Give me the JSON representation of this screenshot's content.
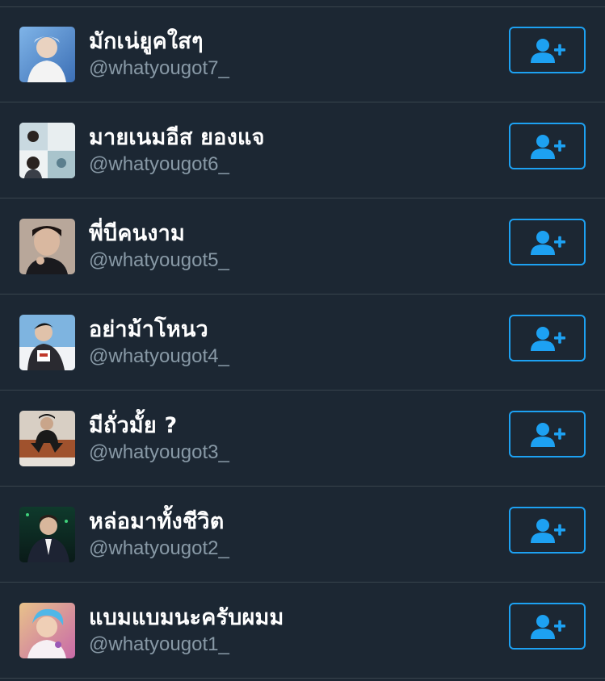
{
  "colors": {
    "background": "#1c2733",
    "divider": "#38444d",
    "name_text": "#ffffff",
    "handle_text": "#8899a6",
    "accent": "#1da1f2"
  },
  "users": [
    {
      "name": "มักเน่ยูคใสๆ",
      "handle": "@whatyougot7_",
      "button_icon": "add-user-icon"
    },
    {
      "name": "มายเนมอีส ยองแจ",
      "handle": "@whatyougot6_",
      "button_icon": "add-user-icon"
    },
    {
      "name": "พี่บีคนงาม",
      "handle": "@whatyougot5_",
      "button_icon": "add-user-icon"
    },
    {
      "name": "อย่าม้าโหนว",
      "handle": "@whatyougot4_",
      "button_icon": "add-user-icon"
    },
    {
      "name": "มีถั่วมั้ย ?",
      "handle": "@whatyougot3_",
      "button_icon": "add-user-icon"
    },
    {
      "name": "หล่อมาทั้งชีวิต",
      "handle": "@whatyougot2_",
      "button_icon": "add-user-icon"
    },
    {
      "name": "แบมแบมนะครับผมม",
      "handle": "@whatyougot1_",
      "button_icon": "add-user-icon"
    }
  ]
}
